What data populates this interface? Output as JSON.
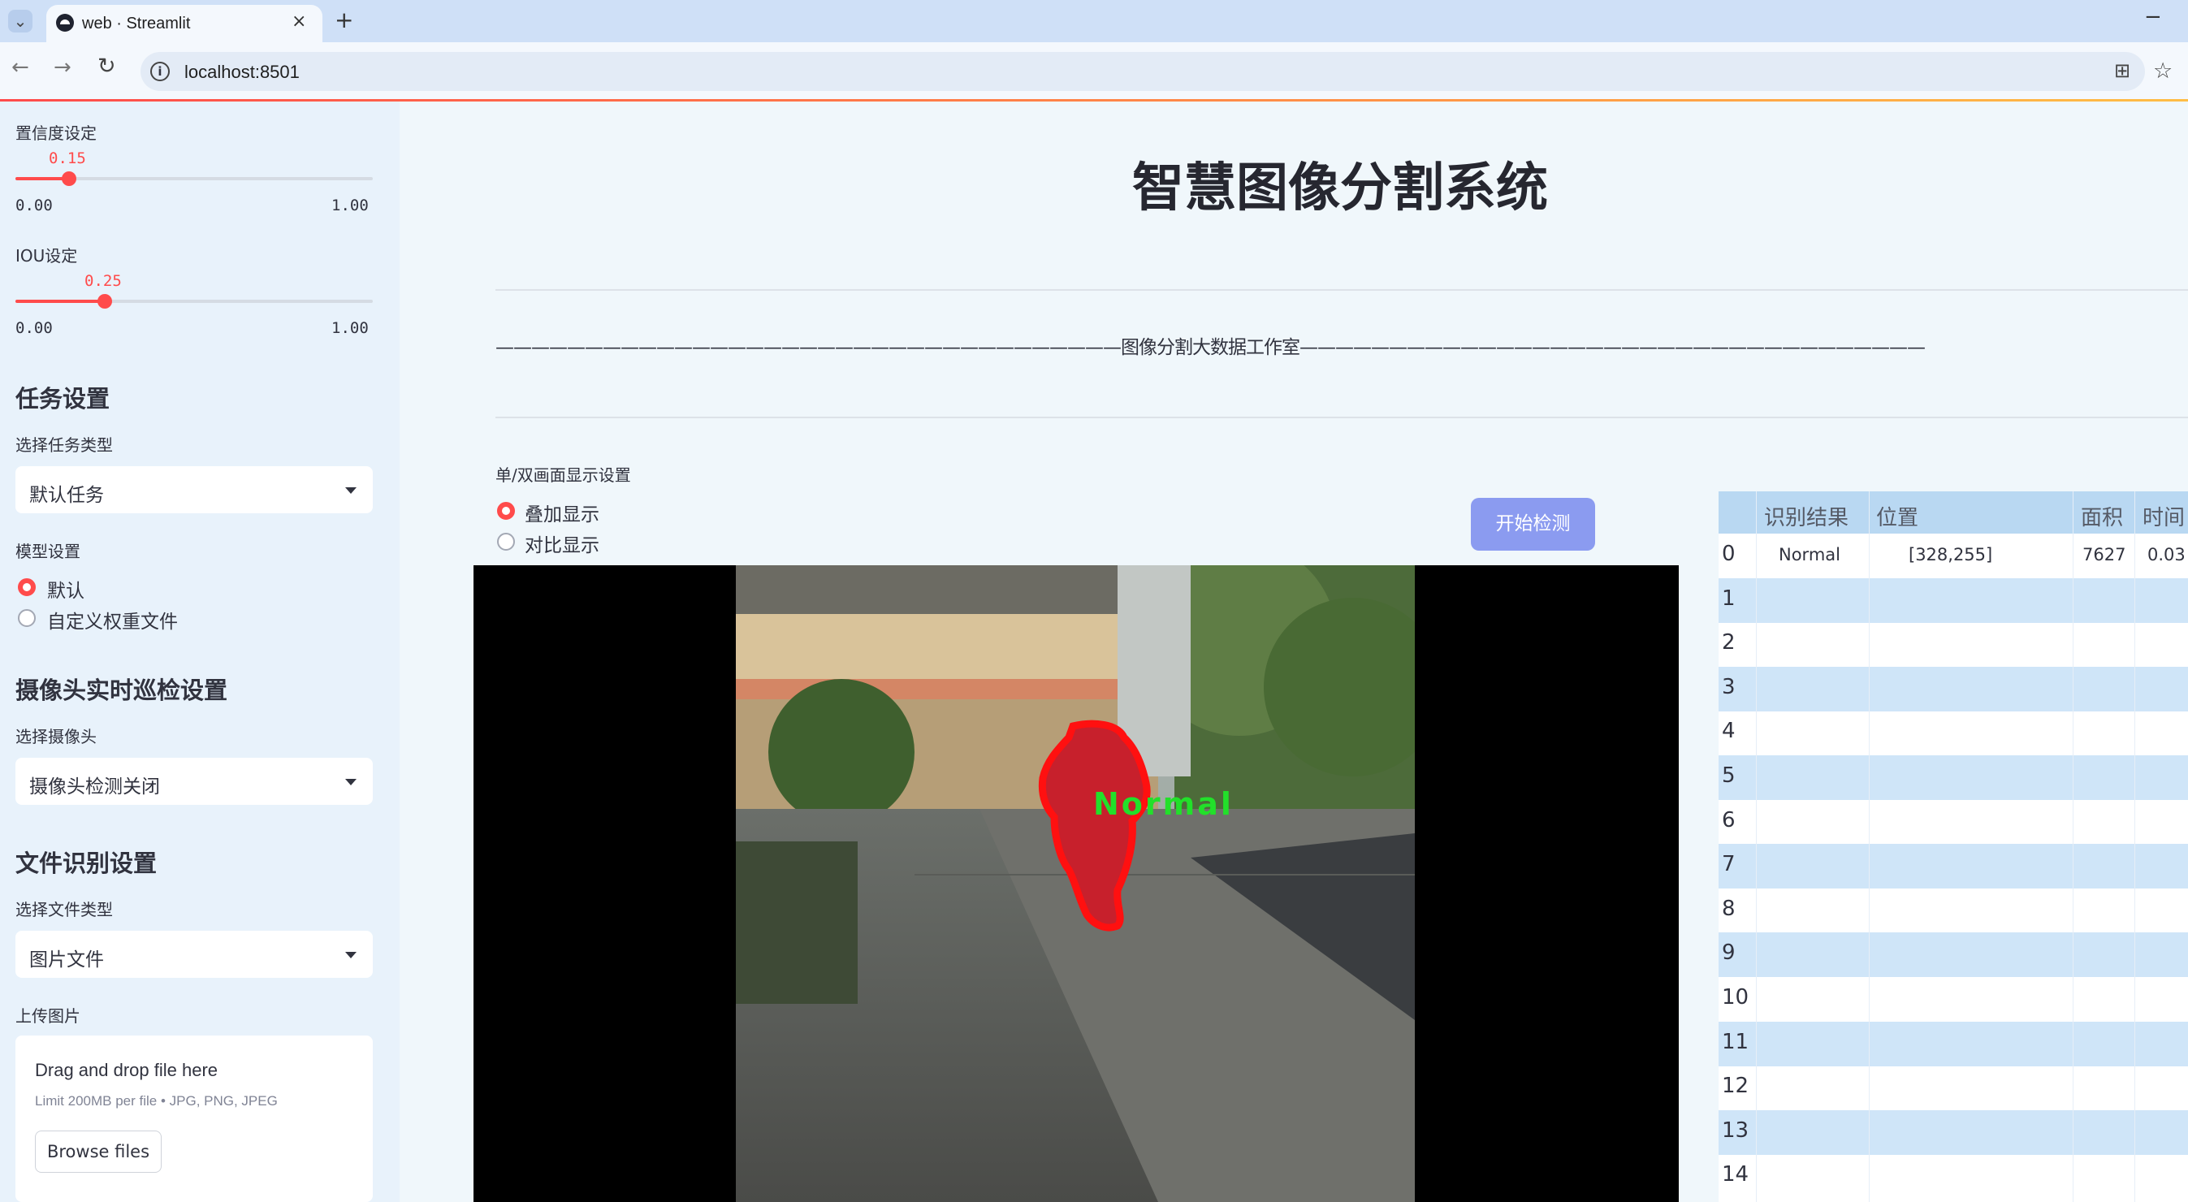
{
  "browser": {
    "tab_title": "web · Streamlit",
    "url": "localhost:8501",
    "icons": [
      "tab-list-icon",
      "streamlit-logo-icon",
      "close-icon",
      "new-tab-icon",
      "back-icon",
      "forward-icon",
      "reload-icon",
      "site-info-icon",
      "translate-icon",
      "bookmark-star-icon",
      "minimize-icon"
    ]
  },
  "sidebar": {
    "confidence": {
      "label": "置信度设定",
      "value": "0.15",
      "value_num": 0.15,
      "min": "0.00",
      "max": "1.00"
    },
    "iou": {
      "label": "IOU设定",
      "value": "0.25",
      "value_num": 0.25,
      "min": "0.00",
      "max": "1.00"
    },
    "task": {
      "header": "任务设置",
      "select_label": "选择任务类型",
      "selected": "默认任务"
    },
    "model": {
      "label": "模型设置",
      "options": [
        "默认",
        "自定义权重文件"
      ],
      "selected_index": 0
    },
    "camera": {
      "header": "摄像头实时巡检设置",
      "select_label": "选择摄像头",
      "selected": "摄像头检测关闭"
    },
    "file": {
      "header": "文件识别设置",
      "select_label": "选择文件类型",
      "selected": "图片文件"
    },
    "upload": {
      "label": "上传图片",
      "drop_text": "Drag and drop file here",
      "limit_text": "Limit 200MB per file • JPG, PNG, JPEG",
      "browse_label": "Browse files"
    }
  },
  "main": {
    "title": "智慧图像分割系统",
    "subtitle": "———————————————————————————————————图像分割大数据工作室———————————————————————————————————",
    "display_setting": {
      "label": "单/双画面显示设置",
      "options": [
        "叠加显示",
        "对比显示"
      ],
      "selected_index": 0
    },
    "start_button": "开始检测",
    "detection_label": "Normal"
  },
  "results_table": {
    "columns": [
      "识别结果",
      "位置",
      "面积",
      "时间"
    ],
    "rows": [
      {
        "index": "0",
        "result": "Normal",
        "position": "[328,255]",
        "area": "7627",
        "time": "0.03"
      },
      {
        "index": "1"
      },
      {
        "index": "2"
      },
      {
        "index": "3"
      },
      {
        "index": "4"
      },
      {
        "index": "5"
      },
      {
        "index": "6"
      },
      {
        "index": "7"
      },
      {
        "index": "8"
      },
      {
        "index": "9"
      },
      {
        "index": "10"
      },
      {
        "index": "11"
      },
      {
        "index": "12"
      },
      {
        "index": "13"
      },
      {
        "index": "14"
      }
    ]
  },
  "colors": {
    "accent": "#ff4b4b",
    "sidebar_bg": "#e8f2fb",
    "button_bg": "#8b9bf0",
    "table_stripe": "#cfe5f8",
    "detection_mask": "#ff1010",
    "detection_text": "#22e02a"
  }
}
